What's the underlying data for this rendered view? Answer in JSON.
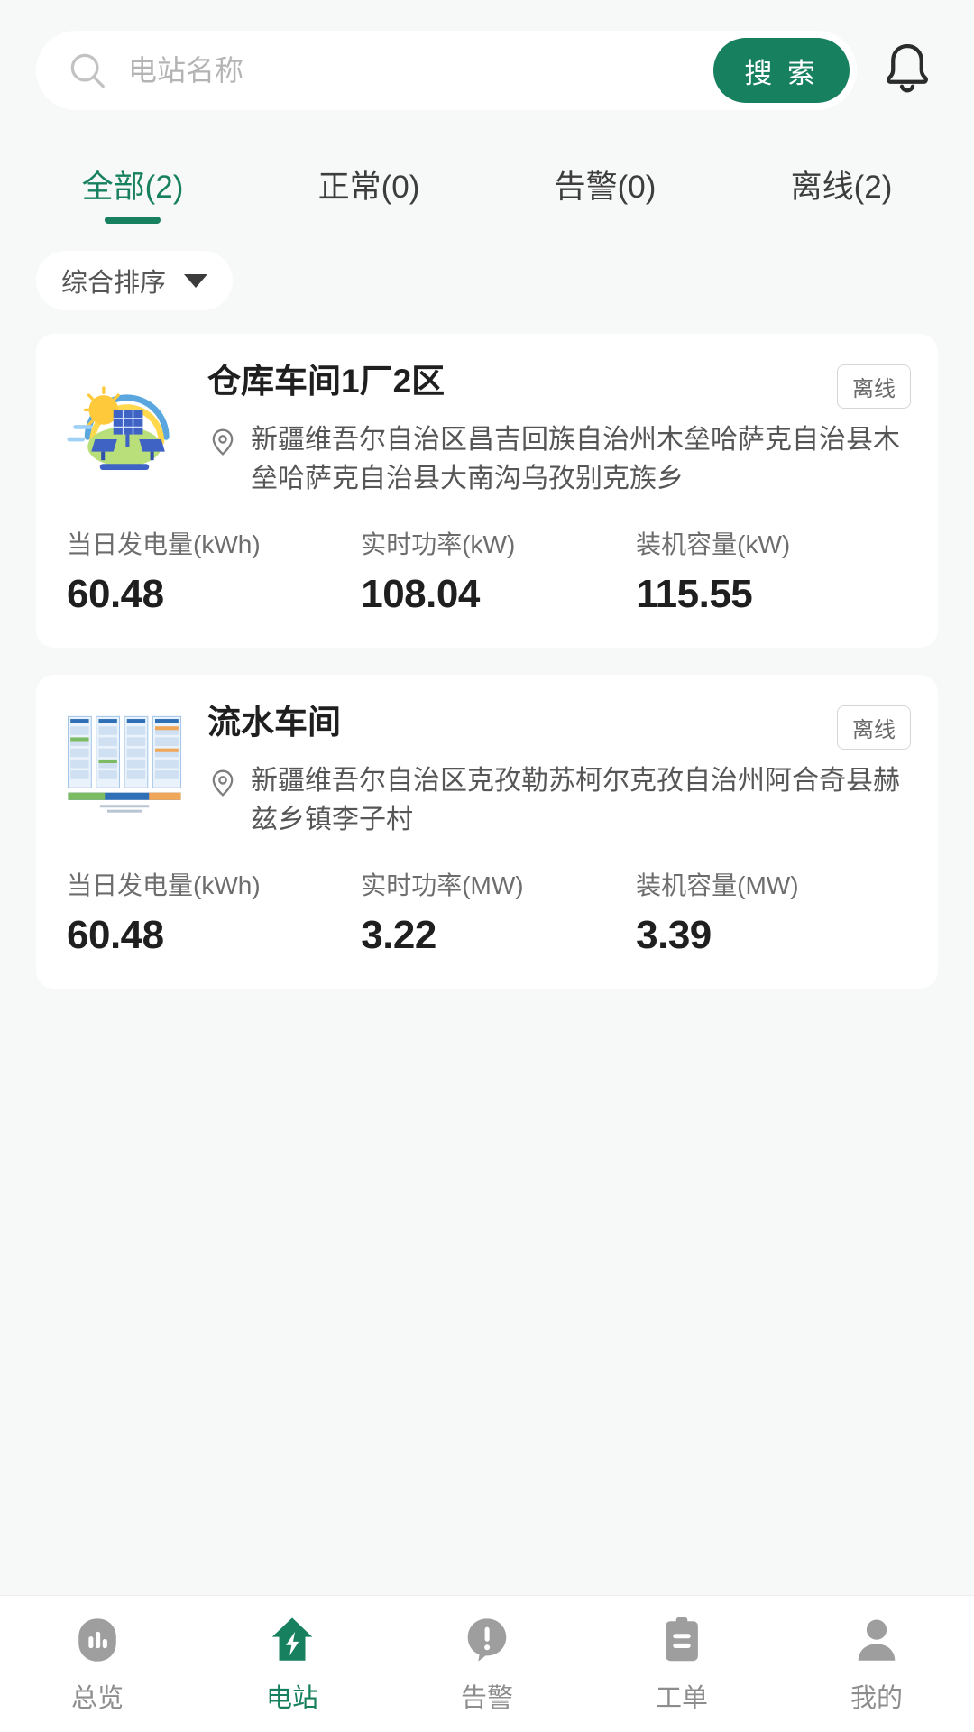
{
  "theme": {
    "accent": "#17805f",
    "muted": "#8d8d8d",
    "page_bg": "#f7f8f8",
    "card_bg": "#ffffff"
  },
  "search": {
    "placeholder": "电站名称",
    "value": "",
    "button_label": "搜 索",
    "search_icon": "search-icon",
    "bell_icon": "bell-icon"
  },
  "tabs": [
    {
      "label": "全部(2)",
      "active": true
    },
    {
      "label": "正常(0)",
      "active": false
    },
    {
      "label": "告警(0)",
      "active": false
    },
    {
      "label": "离线(2)",
      "active": false
    }
  ],
  "sort": {
    "label": "综合排序",
    "caret_icon": "chevron-down-icon"
  },
  "stations": [
    {
      "name": "仓库车间1厂2区",
      "status": "离线",
      "address": "新疆维吾尔自治区昌吉回族自治州木垒哈萨克自治县木垒哈萨克自治县大南沟乌孜别克族乡",
      "thumb_icon": "solar-plant-illustration",
      "pin_icon": "location-pin-icon",
      "metrics": [
        {
          "label": "当日发电量(kWh)",
          "value": "60.48"
        },
        {
          "label": "实时功率(kW)",
          "value": "108.04"
        },
        {
          "label": "装机容量(kW)",
          "value": "115.55"
        }
      ]
    },
    {
      "name": "流水车间",
      "status": "离线",
      "address": "新疆维吾尔自治区克孜勒苏柯尔克孜自治州阿合奇县赫兹乡镇李子村",
      "thumb_icon": "diagram-thumbnail",
      "pin_icon": "location-pin-icon",
      "metrics": [
        {
          "label": "当日发电量(kWh)",
          "value": "60.48"
        },
        {
          "label": "实时功率(MW)",
          "value": "3.22"
        },
        {
          "label": "装机容量(MW)",
          "value": "3.39"
        }
      ]
    }
  ],
  "bottom_nav": [
    {
      "label": "总览",
      "icon": "overview-bars-icon",
      "active": false
    },
    {
      "label": "电站",
      "icon": "power-station-bolt-icon",
      "active": true
    },
    {
      "label": "告警",
      "icon": "alarm-exclamation-icon",
      "active": false
    },
    {
      "label": "工单",
      "icon": "work-order-clipboard-icon",
      "active": false
    },
    {
      "label": "我的",
      "icon": "profile-person-icon",
      "active": false
    }
  ]
}
